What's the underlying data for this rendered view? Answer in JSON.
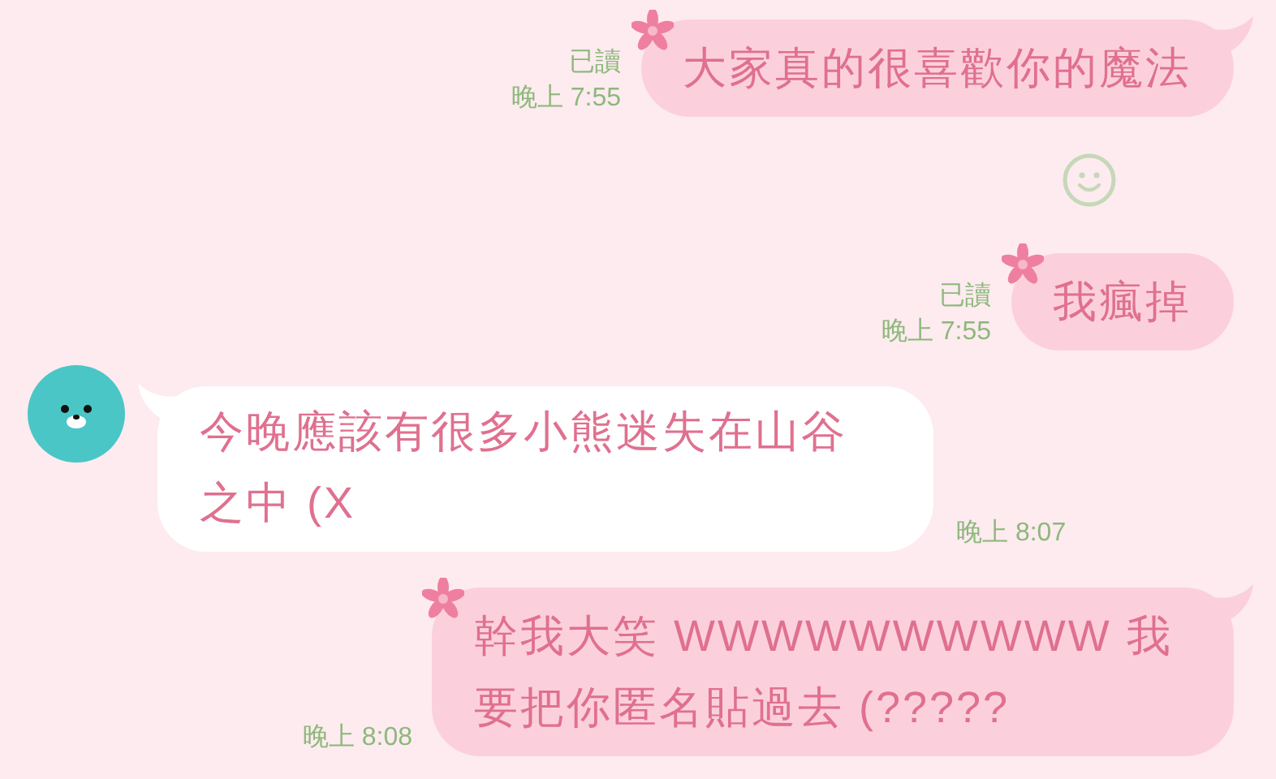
{
  "messages": [
    {
      "kind": "sent",
      "text": "大家真的很喜歡你的魔法",
      "read": "已讀",
      "time": "晚上 7:55",
      "tail": true,
      "flower": true
    },
    {
      "kind": "reaction"
    },
    {
      "kind": "sent",
      "text": "我瘋掉",
      "read": "已讀",
      "time": "晚上 7:55",
      "tail": false,
      "flower": true
    },
    {
      "kind": "received",
      "text": "今晚應該有很多小熊迷失在山谷之中 (X",
      "time": "晚上 8:07",
      "tail": true
    },
    {
      "kind": "sent",
      "text": "幹我大笑 WWWWWWWWWW 我要把你匿名貼過去 (?????",
      "time": "晚上 8:08",
      "tail": true,
      "flower": true
    }
  ]
}
